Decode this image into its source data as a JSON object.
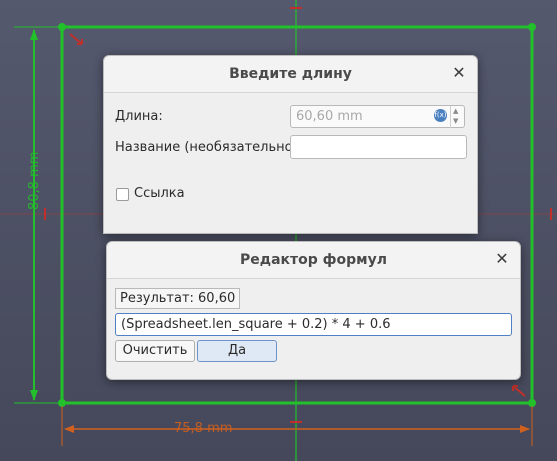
{
  "canvas": {
    "dimension_vertical": "80,8 mm",
    "dimension_horizontal": "75,8 mm",
    "colors": {
      "sketch_line": "#22c02a",
      "dimension": "#d0601d",
      "constraint": "#c0302a"
    }
  },
  "length_dialog": {
    "title": "Введите длину",
    "length_label": "Длина:",
    "length_value": "60,60 mm",
    "name_label": "Название (необязательно)",
    "name_value": "",
    "reference_label": "Ссылка",
    "reference_checked": false,
    "close_icon": "close-icon"
  },
  "formula_dialog": {
    "title": "Редактор формул",
    "result_label": "Результат: 60,60",
    "formula": "(Spreadsheet.len_square + 0.2) * 4 + 0.6",
    "clear_button": "Очистить",
    "ok_button": "Да",
    "close_icon": "close-icon"
  }
}
